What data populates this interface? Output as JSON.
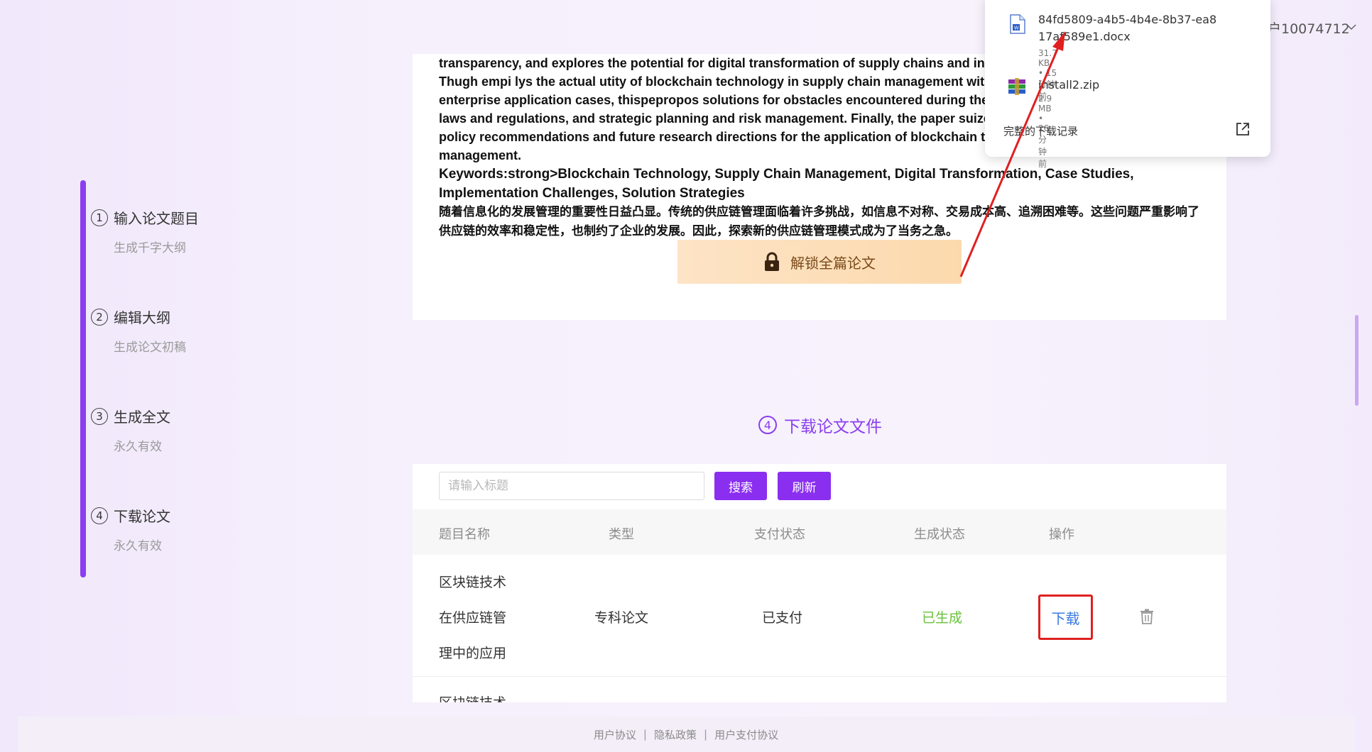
{
  "header": {
    "user_label": "户10074712"
  },
  "sidebar": {
    "steps": [
      {
        "num": "1",
        "title": "输入论文题目",
        "sub": "生成千字大纲"
      },
      {
        "num": "2",
        "title": "编辑大纲",
        "sub": "生成论文初稿"
      },
      {
        "num": "3",
        "title": "生成全文",
        "sub": "永久有效"
      },
      {
        "num": "4",
        "title": "下载论文",
        "sub": "永久有效"
      }
    ]
  },
  "paper": {
    "lines": [
      "transparency, and explores the potential for digital transformation of supply chains and integ",
      "Thugh empi lys the actual utity of blockchain technology in supply chain management with g",
      "enterprise application cases, thispepropos solutions for obstacles encountered during the in",
      "laws and regulations, and strategic planning and risk management. Finally, the paper suizes",
      "policy recommendations and future research directions for the application of blockchain tec",
      "management."
    ],
    "keywords": "Keywords:strong>Blockchain Technology, Supply Chain Management, Digital Transformation, Case Studies, Implementation Challenges, Solution Strategies",
    "chinese_para": "随着信息化的发展管理的重要性日益凸显。传统的供应链管理面临着许多挑战，如信息不对称、交易成本高、追溯困难等。这些问题严重影响了供应链的效率和稳定性，也制约了企业的发展。因此，探索新的供应链管理模式成为了当务之急。",
    "unlock_label": "解锁全篇论文"
  },
  "section": {
    "num": "4",
    "title": "下载论文文件"
  },
  "table": {
    "search_placeholder": "请输入标题",
    "search_label": "搜索",
    "refresh_label": "刷新",
    "headers": [
      "题目名称",
      "类型",
      "支付状态",
      "生成状态",
      "操作"
    ],
    "rows": [
      {
        "title_lines": [
          "区块链技术",
          "在供应链管",
          "理中的应用"
        ],
        "type": "专科论文",
        "pay_status": "已支付",
        "gen_status": "已生成",
        "action": "下载"
      }
    ],
    "partial_row_title": "区块链技术"
  },
  "footer": {
    "links": [
      "用户协议",
      "隐私政策",
      "用户支付协议"
    ],
    "separator": "|"
  },
  "downloads": {
    "items": [
      {
        "name": "84fd5809-a4b5-4b4e-8b37-ea817af589e1.docx",
        "meta": "31.7 KB • 15 分钟前",
        "icon": "word-doc-icon"
      },
      {
        "name": "install2.zip",
        "meta": "2.9 MB • 26 分钟前",
        "icon": "winrar-archive-icon"
      }
    ],
    "all_label": "完整的下载记录"
  },
  "colors": {
    "accent": "#8a3ef0",
    "button": "#8a2ef0",
    "success": "#67c23a",
    "link": "#3a7be0",
    "highlight": "#e02020"
  }
}
